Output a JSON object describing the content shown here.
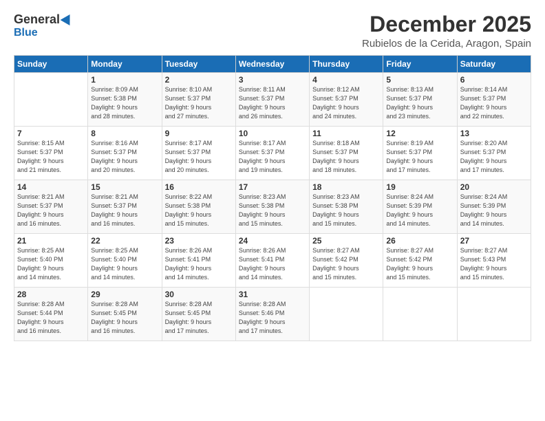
{
  "logo": {
    "general": "General",
    "blue": "Blue"
  },
  "header": {
    "month": "December 2025",
    "location": "Rubielos de la Cerida, Aragon, Spain"
  },
  "weekdays": [
    "Sunday",
    "Monday",
    "Tuesday",
    "Wednesday",
    "Thursday",
    "Friday",
    "Saturday"
  ],
  "weeks": [
    [
      {
        "day": "",
        "info": ""
      },
      {
        "day": "1",
        "info": "Sunrise: 8:09 AM\nSunset: 5:38 PM\nDaylight: 9 hours\nand 28 minutes."
      },
      {
        "day": "2",
        "info": "Sunrise: 8:10 AM\nSunset: 5:37 PM\nDaylight: 9 hours\nand 27 minutes."
      },
      {
        "day": "3",
        "info": "Sunrise: 8:11 AM\nSunset: 5:37 PM\nDaylight: 9 hours\nand 26 minutes."
      },
      {
        "day": "4",
        "info": "Sunrise: 8:12 AM\nSunset: 5:37 PM\nDaylight: 9 hours\nand 24 minutes."
      },
      {
        "day": "5",
        "info": "Sunrise: 8:13 AM\nSunset: 5:37 PM\nDaylight: 9 hours\nand 23 minutes."
      },
      {
        "day": "6",
        "info": "Sunrise: 8:14 AM\nSunset: 5:37 PM\nDaylight: 9 hours\nand 22 minutes."
      }
    ],
    [
      {
        "day": "7",
        "info": "Sunrise: 8:15 AM\nSunset: 5:37 PM\nDaylight: 9 hours\nand 21 minutes."
      },
      {
        "day": "8",
        "info": "Sunrise: 8:16 AM\nSunset: 5:37 PM\nDaylight: 9 hours\nand 20 minutes."
      },
      {
        "day": "9",
        "info": "Sunrise: 8:17 AM\nSunset: 5:37 PM\nDaylight: 9 hours\nand 20 minutes."
      },
      {
        "day": "10",
        "info": "Sunrise: 8:17 AM\nSunset: 5:37 PM\nDaylight: 9 hours\nand 19 minutes."
      },
      {
        "day": "11",
        "info": "Sunrise: 8:18 AM\nSunset: 5:37 PM\nDaylight: 9 hours\nand 18 minutes."
      },
      {
        "day": "12",
        "info": "Sunrise: 8:19 AM\nSunset: 5:37 PM\nDaylight: 9 hours\nand 17 minutes."
      },
      {
        "day": "13",
        "info": "Sunrise: 8:20 AM\nSunset: 5:37 PM\nDaylight: 9 hours\nand 17 minutes."
      }
    ],
    [
      {
        "day": "14",
        "info": "Sunrise: 8:21 AM\nSunset: 5:37 PM\nDaylight: 9 hours\nand 16 minutes."
      },
      {
        "day": "15",
        "info": "Sunrise: 8:21 AM\nSunset: 5:37 PM\nDaylight: 9 hours\nand 16 minutes."
      },
      {
        "day": "16",
        "info": "Sunrise: 8:22 AM\nSunset: 5:38 PM\nDaylight: 9 hours\nand 15 minutes."
      },
      {
        "day": "17",
        "info": "Sunrise: 8:23 AM\nSunset: 5:38 PM\nDaylight: 9 hours\nand 15 minutes."
      },
      {
        "day": "18",
        "info": "Sunrise: 8:23 AM\nSunset: 5:38 PM\nDaylight: 9 hours\nand 15 minutes."
      },
      {
        "day": "19",
        "info": "Sunrise: 8:24 AM\nSunset: 5:39 PM\nDaylight: 9 hours\nand 14 minutes."
      },
      {
        "day": "20",
        "info": "Sunrise: 8:24 AM\nSunset: 5:39 PM\nDaylight: 9 hours\nand 14 minutes."
      }
    ],
    [
      {
        "day": "21",
        "info": "Sunrise: 8:25 AM\nSunset: 5:40 PM\nDaylight: 9 hours\nand 14 minutes."
      },
      {
        "day": "22",
        "info": "Sunrise: 8:25 AM\nSunset: 5:40 PM\nDaylight: 9 hours\nand 14 minutes."
      },
      {
        "day": "23",
        "info": "Sunrise: 8:26 AM\nSunset: 5:41 PM\nDaylight: 9 hours\nand 14 minutes."
      },
      {
        "day": "24",
        "info": "Sunrise: 8:26 AM\nSunset: 5:41 PM\nDaylight: 9 hours\nand 14 minutes."
      },
      {
        "day": "25",
        "info": "Sunrise: 8:27 AM\nSunset: 5:42 PM\nDaylight: 9 hours\nand 15 minutes."
      },
      {
        "day": "26",
        "info": "Sunrise: 8:27 AM\nSunset: 5:42 PM\nDaylight: 9 hours\nand 15 minutes."
      },
      {
        "day": "27",
        "info": "Sunrise: 8:27 AM\nSunset: 5:43 PM\nDaylight: 9 hours\nand 15 minutes."
      }
    ],
    [
      {
        "day": "28",
        "info": "Sunrise: 8:28 AM\nSunset: 5:44 PM\nDaylight: 9 hours\nand 16 minutes."
      },
      {
        "day": "29",
        "info": "Sunrise: 8:28 AM\nSunset: 5:45 PM\nDaylight: 9 hours\nand 16 minutes."
      },
      {
        "day": "30",
        "info": "Sunrise: 8:28 AM\nSunset: 5:45 PM\nDaylight: 9 hours\nand 17 minutes."
      },
      {
        "day": "31",
        "info": "Sunrise: 8:28 AM\nSunset: 5:46 PM\nDaylight: 9 hours\nand 17 minutes."
      },
      {
        "day": "",
        "info": ""
      },
      {
        "day": "",
        "info": ""
      },
      {
        "day": "",
        "info": ""
      }
    ]
  ]
}
